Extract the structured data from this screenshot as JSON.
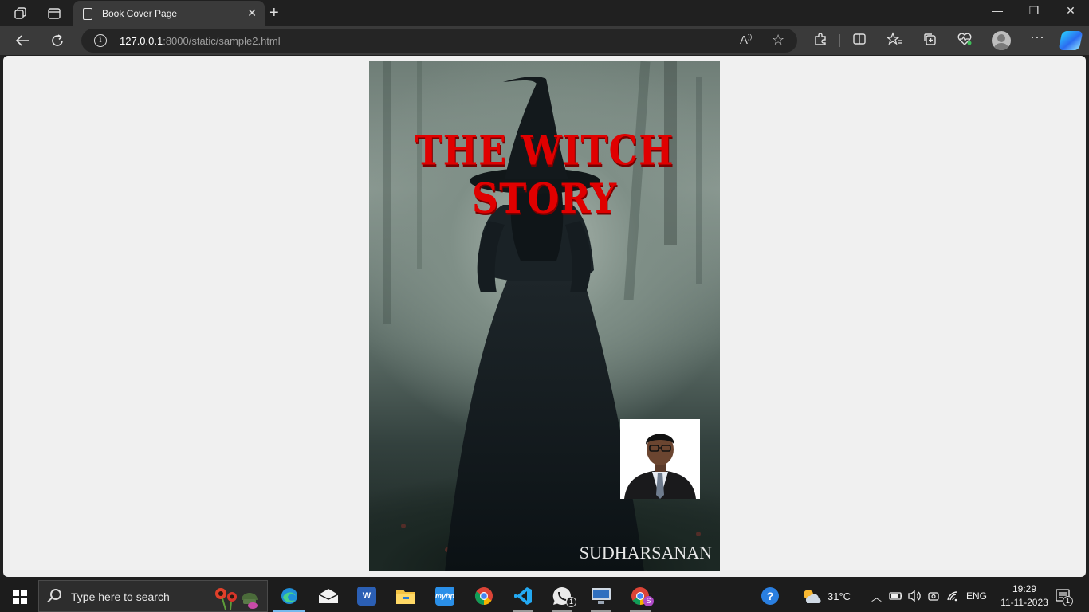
{
  "browser": {
    "tab_title": "Book Cover Page",
    "url_host": "127.0.0.1",
    "url_rest": ":8000/static/sample2.html",
    "read_aloud_label": "A",
    "accent_color": "#76b9ed"
  },
  "book": {
    "title": "THE WITCH STORY",
    "author": "SUDHARSANAN",
    "title_color": "#e00000"
  },
  "taskbar": {
    "search_placeholder": "Type here to search",
    "apps": [
      "edge-icon",
      "mail-icon",
      "word-icon",
      "file-explorer-icon",
      "myhp-icon",
      "chrome-icon",
      "vscode-icon",
      "whatsapp-icon",
      "remote-desktop-icon",
      "chrome-profile-icon"
    ],
    "whatsapp_badge": "1",
    "chrome_profile_badge": "S",
    "myhp_label": "myhp",
    "word_label": "W",
    "weather": "31°C",
    "language": "ENG",
    "time": "19:29",
    "date": "11-11-2023",
    "notification_count": "1",
    "help_label": "?"
  }
}
